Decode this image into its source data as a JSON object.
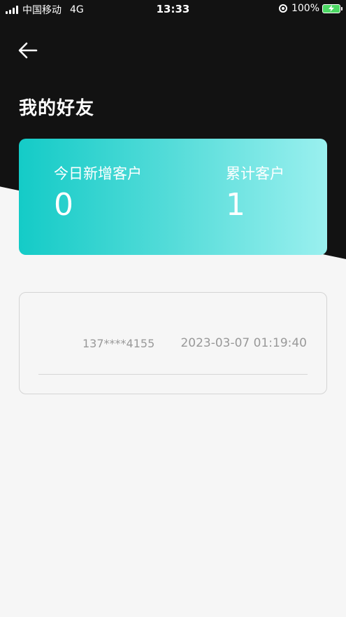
{
  "status_bar": {
    "carrier": "中国移动",
    "network": "4G",
    "time": "13:33",
    "battery": "100%"
  },
  "header": {
    "title": "我的好友"
  },
  "stats": {
    "today_label": "今日新增客户",
    "today_value": "0",
    "total_label": "累计客户",
    "total_value": "1"
  },
  "friends": [
    {
      "phone": "137****4155",
      "time": "2023-03-07 01:19:40"
    }
  ],
  "colors": {
    "header_bg": "#121212",
    "card_gradient_start": "#14cbc7",
    "card_gradient_end": "#9af0ef",
    "muted_text": "#999999"
  }
}
